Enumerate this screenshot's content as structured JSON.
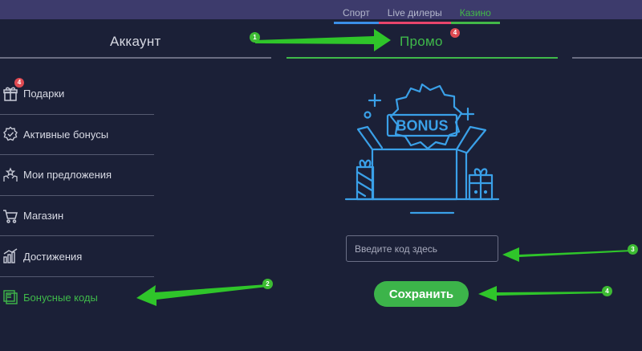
{
  "top_nav": {
    "items": [
      "Спорт",
      "Live дилеры",
      "Казино"
    ],
    "active": "Казино"
  },
  "tabs": {
    "account": "Аккаунт",
    "promo": "Промо",
    "promo_badge": "4"
  },
  "sidebar": {
    "items": [
      {
        "label": "Подарки",
        "icon": "gift-icon",
        "badge": "4"
      },
      {
        "label": "Активные бонусы",
        "icon": "bonus-badge-icon"
      },
      {
        "label": "Мои предложения",
        "icon": "star-hands-icon"
      },
      {
        "label": "Магазин",
        "icon": "cart-icon"
      },
      {
        "label": "Достижения",
        "icon": "bar-chart-icon"
      },
      {
        "label": "Бонусные коды",
        "icon": "bonus-code-icon",
        "active": true
      }
    ]
  },
  "promo": {
    "illustration_text": "BONUS",
    "code_placeholder": "Введите код здесь",
    "save_label": "Сохранить"
  },
  "annotations": {
    "steps": [
      "1",
      "2",
      "3",
      "4"
    ]
  },
  "colors": {
    "background": "#1b2037",
    "topbar": "#3d3b6c",
    "accent_green": "#3fb94a",
    "illustration_blue": "#3aa0e8",
    "badge_red": "#e04a52",
    "arrow_green": "#2fc52a"
  }
}
